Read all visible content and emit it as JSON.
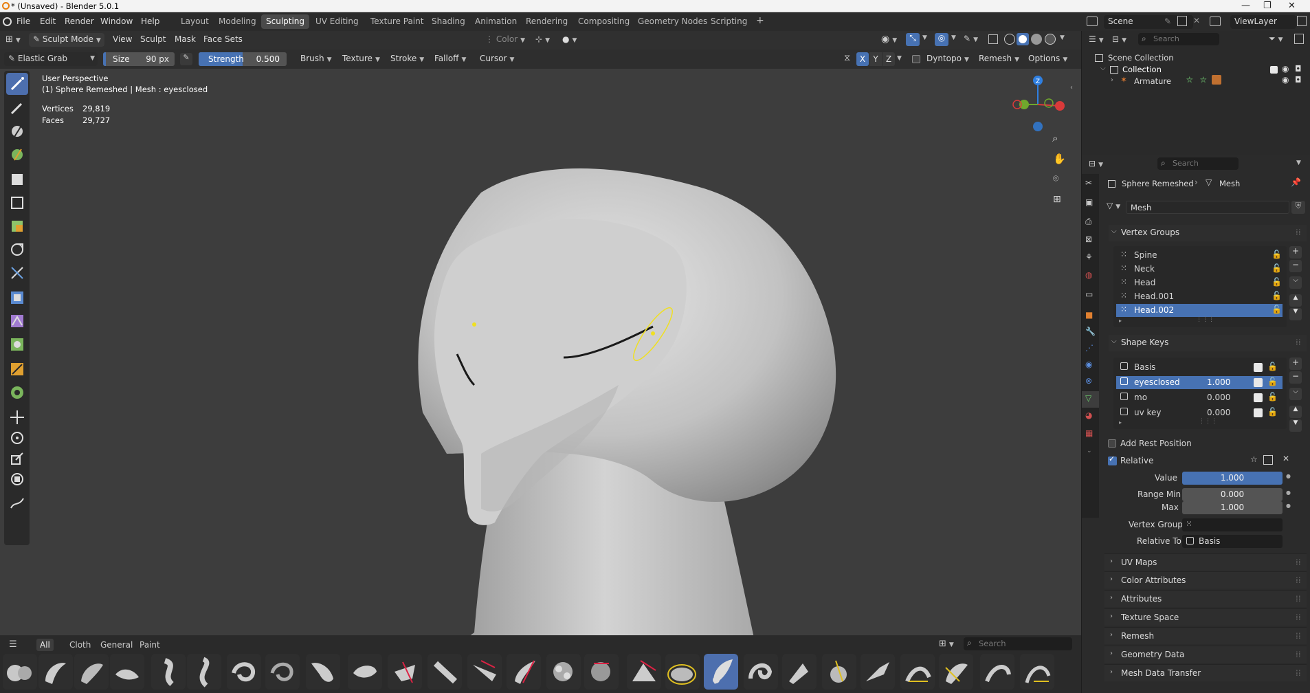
{
  "window": {
    "title": "* (Unsaved) - Blender 5.0.1"
  },
  "menus": [
    "File",
    "Edit",
    "Render",
    "Window",
    "Help"
  ],
  "workspaces": [
    "Layout",
    "Modeling",
    "Sculpting",
    "UV Editing",
    "Texture Paint",
    "Shading",
    "Animation",
    "Rendering",
    "Compositing",
    "Geometry Nodes",
    "Scripting"
  ],
  "active_workspace": "Sculpting",
  "scene": {
    "name": "Scene",
    "view_layer": "ViewLayer"
  },
  "viewport_header": {
    "mode": "Sculpt Mode",
    "menus": [
      "View",
      "Sculpt",
      "Mask",
      "Face Sets"
    ],
    "color_label": "Color"
  },
  "tool_settings": {
    "brush": "Elastic Grab",
    "size_label": "Size",
    "size_value": "90 px",
    "strength_label": "Strength",
    "strength_value": "0.500",
    "strength_fraction": 0.5,
    "dropdowns": [
      "Brush",
      "Texture",
      "Stroke",
      "Falloff",
      "Cursor"
    ],
    "axes": [
      "X",
      "Y",
      "Z"
    ],
    "dyntopo": "Dyntopo",
    "remesh": "Remesh",
    "options": "Options"
  },
  "overlay": {
    "perspective": "User Perspective",
    "object_info": "(1) Sphere Remeshed | Mesh : eyesclosed",
    "vertices_label": "Vertices",
    "vertices_value": "29,819",
    "faces_label": "Faces",
    "faces_value": "29,727"
  },
  "gizmo": {
    "z": "Z"
  },
  "asset_shelf": {
    "tabs": [
      "All",
      "Cloth",
      "General",
      "Paint"
    ],
    "active_tab": "All",
    "search_placeholder": "Search"
  },
  "outliner": {
    "search_placeholder": "Search",
    "scene_collection": "Scene Collection",
    "collection": "Collection",
    "armature": "Armature"
  },
  "properties": {
    "search_placeholder": "Search",
    "breadcrumb_object": "Sphere Remeshed",
    "breadcrumb_data": "Mesh",
    "mesh_name": "Mesh",
    "vertex_groups_title": "Vertex Groups",
    "vertex_groups": [
      "Spine",
      "Neck",
      "Head",
      "Head.001",
      "Head.002"
    ],
    "selected_vertex_group": "Head.002",
    "shape_keys_title": "Shape Keys",
    "shape_keys": [
      {
        "name": "Basis",
        "value": ""
      },
      {
        "name": "eyesclosed",
        "value": "1.000"
      },
      {
        "name": "mo",
        "value": "0.000"
      },
      {
        "name": "uv key",
        "value": "0.000"
      }
    ],
    "selected_shape_key": "eyesclosed",
    "add_rest_position": "Add Rest Position",
    "relative": "Relative",
    "value_label": "Value",
    "value": "1.000",
    "range_min_label": "Range Min",
    "range_min": "0.000",
    "max_label": "Max",
    "max": "1.000",
    "vertex_group_label": "Vertex Group",
    "vertex_group_value": "",
    "relative_to_label": "Relative To",
    "relative_to": "Basis",
    "collapsed_panels": [
      "UV Maps",
      "Color Attributes",
      "Attributes",
      "Texture Space",
      "Remesh",
      "Geometry Data",
      "Mesh Data Transfer"
    ]
  },
  "colors": {
    "accent": "#4772b3",
    "viewport_bg": "#3d3d3d",
    "panel_bg": "#2b2b2b",
    "header_bg": "#303030",
    "selection_yellow": "#f0e020"
  }
}
